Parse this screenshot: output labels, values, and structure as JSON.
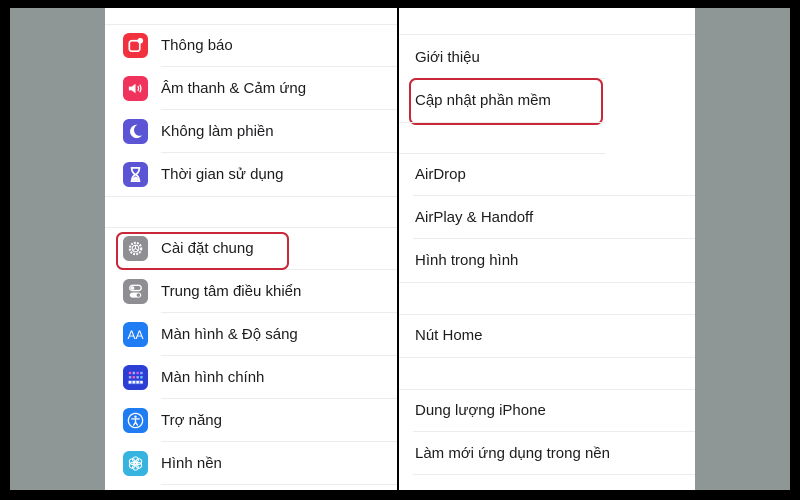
{
  "left_panel": {
    "items": [
      {
        "label": "Thông báo",
        "icon": "notifications-icon",
        "color": "#f2313f"
      },
      {
        "label": "Âm thanh & Cảm ứng",
        "icon": "sound-icon",
        "color": "#f0335c"
      },
      {
        "label": "Không làm phiền",
        "icon": "moon-icon",
        "color": "#5b55d6"
      },
      {
        "label": "Thời gian sử dụng",
        "icon": "hourglass-icon",
        "color": "#5b55d6"
      },
      {
        "label": "Cài đặt chung",
        "icon": "gear-icon",
        "color": "#8e8e93"
      },
      {
        "label": "Trung tâm điều khiển",
        "icon": "toggles-icon",
        "color": "#8e8e93"
      },
      {
        "label": "Màn hình & Độ sáng",
        "icon": "text-size-icon",
        "color": "#1f7cf2",
        "glyph": "AA"
      },
      {
        "label": "Màn hình chính",
        "icon": "home-grid-icon",
        "color": "#2c3fd4"
      },
      {
        "label": "Trợ năng",
        "icon": "accessibility-icon",
        "color": "#1f7cf2"
      },
      {
        "label": "Hình nền",
        "icon": "wallpaper-icon",
        "color": "#36b3de"
      }
    ],
    "highlighted": "Cài đặt chung"
  },
  "right_panel": {
    "items": [
      {
        "label": "Giới thiệu"
      },
      {
        "label": "Cập nhật phần mềm"
      },
      {
        "label": "AirDrop"
      },
      {
        "label": "AirPlay & Handoff"
      },
      {
        "label": "Hình trong hình"
      },
      {
        "label": "Nút Home"
      },
      {
        "label": "Dung lượng iPhone"
      },
      {
        "label": "Làm mới ứng dụng trong nền"
      }
    ],
    "highlighted": "Cập nhật phần mềm"
  },
  "colors": {
    "highlight_border": "#c8283a",
    "background_gray": "#8f9696",
    "panel_white": "#ffffff"
  }
}
